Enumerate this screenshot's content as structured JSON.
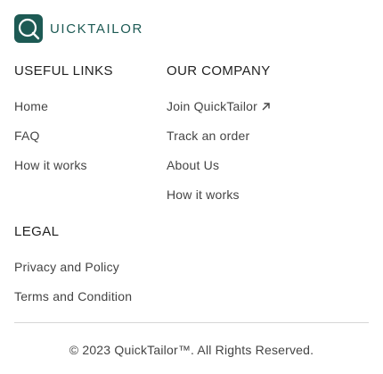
{
  "brand": {
    "name": "UICKTAILOR",
    "logo_icon": "q-logo-icon",
    "color": "#1d5a54"
  },
  "sections": {
    "useful_links": {
      "title": "USEFUL LINKS",
      "items": [
        {
          "label": "Home"
        },
        {
          "label": "FAQ"
        },
        {
          "label": "How it works"
        }
      ]
    },
    "our_company": {
      "title": "OUR COMPANY",
      "items": [
        {
          "label": "Join QuickTailor",
          "icon": "external-link-icon"
        },
        {
          "label": "Track an order"
        },
        {
          "label": "About Us"
        },
        {
          "label": "How it works"
        }
      ]
    },
    "legal": {
      "title": "LEGAL",
      "items": [
        {
          "label": "Privacy and Policy"
        },
        {
          "label": "Terms and Condition"
        }
      ]
    }
  },
  "footer": {
    "copyright": "© 2023 QuickTailor™. All Rights Reserved."
  }
}
